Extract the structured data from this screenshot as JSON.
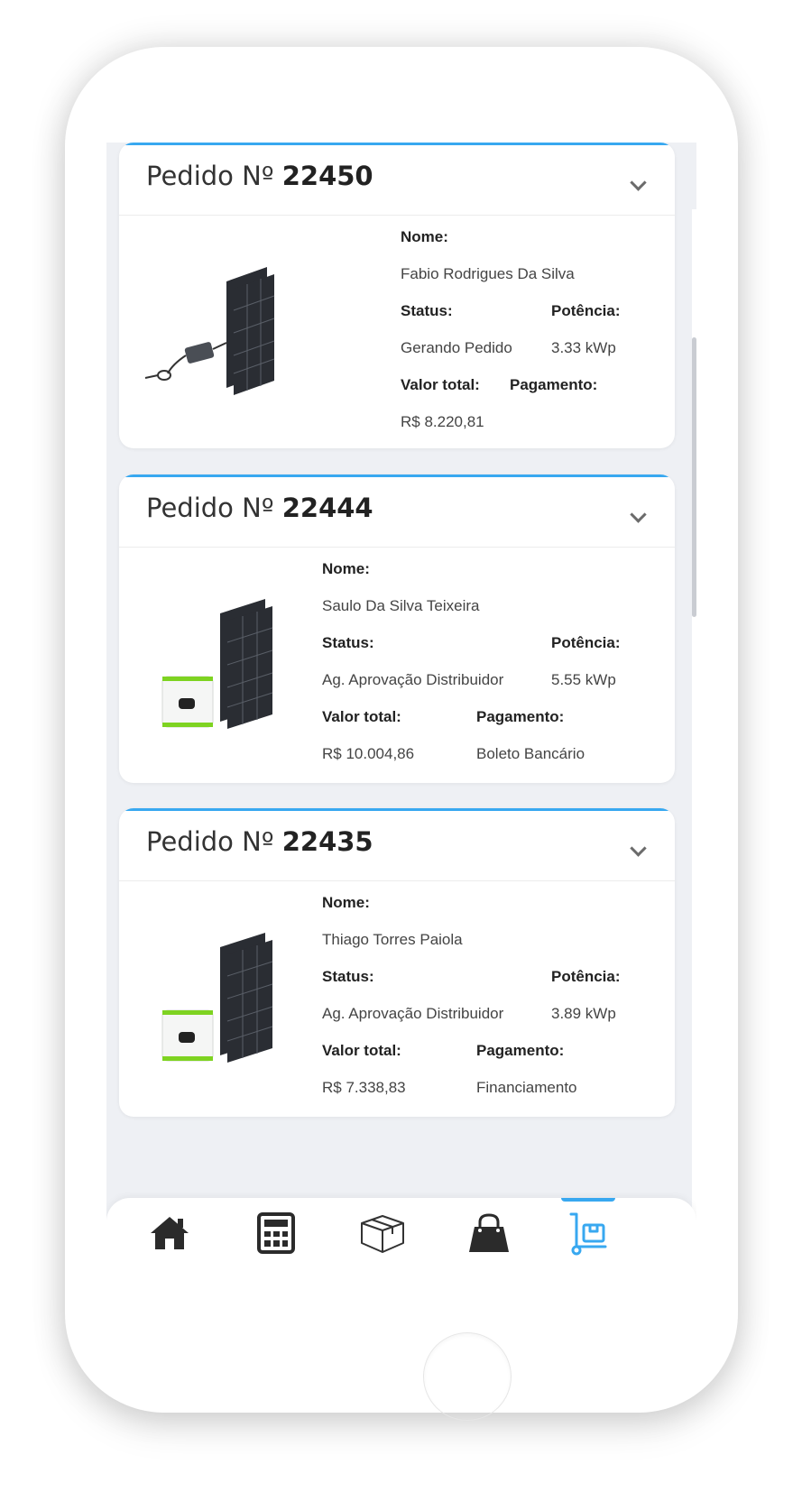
{
  "orders": [
    {
      "title_prefix": "Pedido Nº",
      "number": "22450",
      "name_label": "Nome:",
      "name": "Fabio Rodrigues Da Silva",
      "status_label": "Status:",
      "status": "Gerando Pedido",
      "power_label": "Potência:",
      "power": "3.33 kWp",
      "total_label": "Valor total:",
      "total": "R$ 8.220,81",
      "payment_label": "Pagamento:",
      "payment": "",
      "product": "microinverter-kit"
    },
    {
      "title_prefix": "Pedido Nº",
      "number": "22444",
      "name_label": "Nome:",
      "name": "Saulo Da Silva Teixeira",
      "status_label": "Status:",
      "status": "Ag. Aprovação Distribuidor",
      "power_label": "Potência:",
      "power": "5.55 kWp",
      "total_label": "Valor total:",
      "total": "R$ 10.004,86",
      "payment_label": "Pagamento:",
      "payment": "Boleto Bancário",
      "product": "inverter-kit"
    },
    {
      "title_prefix": "Pedido Nº",
      "number": "22435",
      "name_label": "Nome:",
      "name": "Thiago Torres Paiola",
      "status_label": "Status:",
      "status": "Ag. Aprovação Distribuidor",
      "power_label": "Potência:",
      "power": "3.89 kWp",
      "total_label": "Valor total:",
      "total": "R$ 7.338,83",
      "payment_label": "Pagamento:",
      "payment": "Financiamento",
      "product": "inverter-kit"
    }
  ],
  "nav": {
    "items": [
      "home-icon",
      "calculator-icon",
      "box-icon",
      "shopping-bag-icon",
      "orders-cart-icon"
    ],
    "active": "orders-cart-icon"
  },
  "colors": {
    "accent": "#38a8f0",
    "screen_bg": "#eef0f4",
    "inverter_green": "#7ed321"
  }
}
